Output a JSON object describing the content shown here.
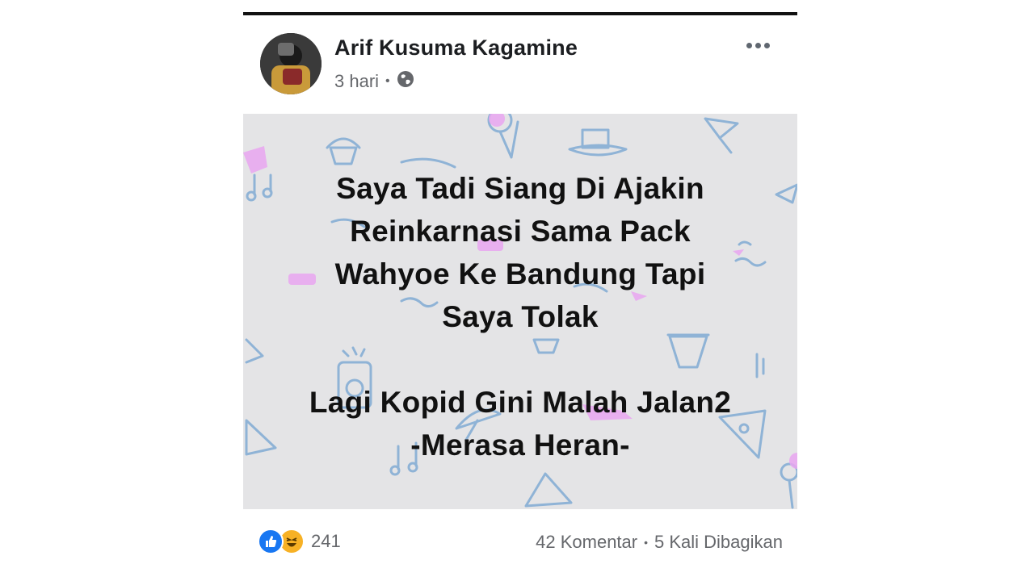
{
  "post": {
    "author": "Arif Kusuma Kagamine",
    "timestamp": "3 hari",
    "separator": "•",
    "privacy_icon": "globe-icon",
    "menu_icon": "more-horizontal-icon",
    "background_color": "#e4e4e6",
    "text_lines_group1": [
      "Saya Tadi Siang Di Ajakin",
      "Reinkarnasi Sama Pack",
      "Wahyoe Ke Bandung Tapi",
      "Saya Tolak"
    ],
    "text_lines_group2": [
      "Lagi Kopid Gini Malah Jalan2",
      "-Merasa Heran-"
    ]
  },
  "footer": {
    "reaction_icons": [
      "like-icon",
      "haha-icon"
    ],
    "reaction_count": "241",
    "comments": "42 Komentar",
    "separator": "•",
    "shares": "5 Kali Dibagikan"
  },
  "colors": {
    "like": "#1877f2",
    "haha": "#f7b125",
    "doodle_blue": "#8fb3d6",
    "doodle_pink": "#e9a6f0"
  }
}
